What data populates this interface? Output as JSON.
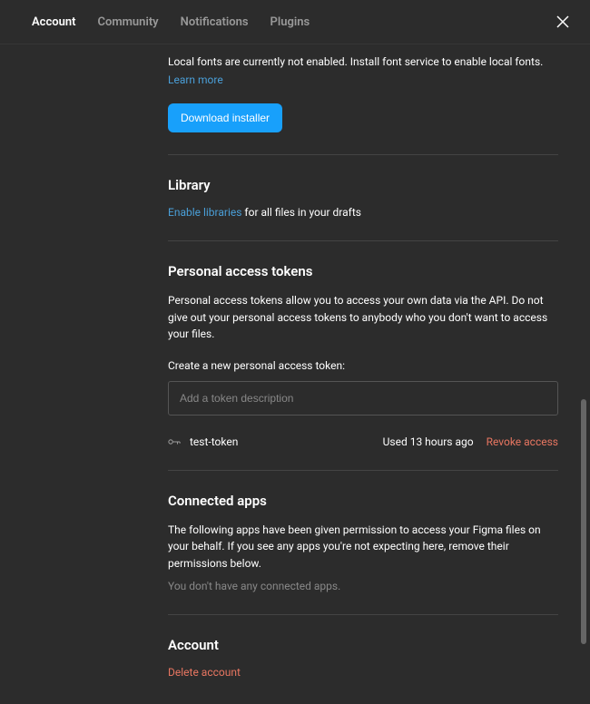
{
  "tabs": {
    "account": "Account",
    "community": "Community",
    "notifications": "Notifications",
    "plugins": "Plugins"
  },
  "fonts": {
    "description": "Local fonts are currently not enabled. Install font service to enable local fonts.",
    "learn_more": "Learn more",
    "download_btn": "Download installer"
  },
  "library": {
    "title": "Library",
    "enable_link": "Enable libraries",
    "suffix": " for all files in your drafts"
  },
  "tokens": {
    "title": "Personal access tokens",
    "description": "Personal access tokens allow you to access your own data via the API. Do not give out your personal access tokens to anybody who you don't want to access your files.",
    "create_label": "Create a new personal access token:",
    "placeholder": "Add a token description",
    "item": {
      "name": "test-token",
      "used": "Used 13 hours ago",
      "revoke": "Revoke access"
    }
  },
  "connected": {
    "title": "Connected apps",
    "description": "The following apps have been given permission to access your Figma files on your behalf. If you see any apps you're not expecting here, remove their permissions below.",
    "empty": "You don't have any connected apps."
  },
  "account": {
    "title": "Account",
    "delete": "Delete account"
  }
}
